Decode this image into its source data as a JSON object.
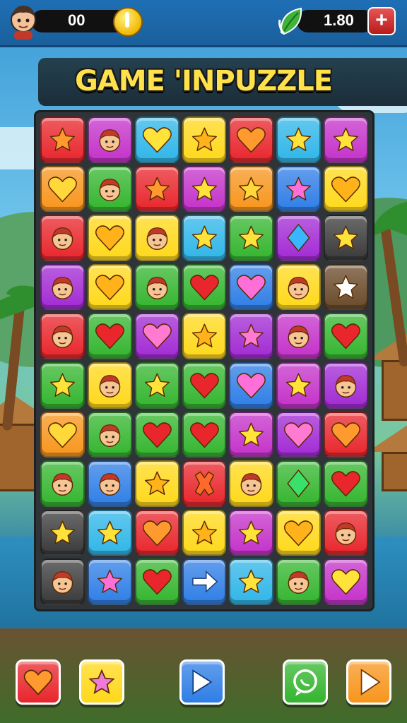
{
  "hud": {
    "coins": "00",
    "energy": "1.80",
    "plus_label": "+"
  },
  "title": "GAME 'INPUZZLE",
  "colors": {
    "red": "#e8262c",
    "orange": "#f7951d",
    "yellow": "#ffd81a",
    "green": "#34b52f",
    "cyan": "#2fb6e8",
    "blue": "#2f7ee6",
    "purple": "#a22ad4",
    "magenta": "#c432c9",
    "dark": "#3a3a3a",
    "brown": "#6a4a2a"
  },
  "board": {
    "rows": [
      [
        [
          "red",
          "star"
        ],
        [
          "magenta",
          "face"
        ],
        [
          "cyan",
          "heart"
        ],
        [
          "yellow",
          "star"
        ],
        [
          "red",
          "heart"
        ],
        [
          "cyan",
          "star"
        ],
        [
          "magenta",
          "star"
        ]
      ],
      [
        [
          "orange",
          "heart"
        ],
        [
          "green",
          "face"
        ],
        [
          "red",
          "star"
        ],
        [
          "magenta",
          "star"
        ],
        [
          "orange",
          "star"
        ],
        [
          "blue",
          "star"
        ],
        [
          "yellow",
          "heart"
        ]
      ],
      [
        [
          "red",
          "face"
        ],
        [
          "yellow",
          "heart"
        ],
        [
          "yellow",
          "face"
        ],
        [
          "cyan",
          "star"
        ],
        [
          "green",
          "star"
        ],
        [
          "purple",
          "diamond"
        ],
        [
          "dark",
          "star"
        ]
      ],
      [
        [
          "purple",
          "face"
        ],
        [
          "yellow",
          "heart"
        ],
        [
          "green",
          "face"
        ],
        [
          "green",
          "heart"
        ],
        [
          "blue",
          "heart"
        ],
        [
          "yellow",
          "face"
        ],
        [
          "brown",
          "star"
        ]
      ],
      [
        [
          "red",
          "face"
        ],
        [
          "green",
          "heart"
        ],
        [
          "purple",
          "heart"
        ],
        [
          "yellow",
          "star"
        ],
        [
          "purple",
          "star"
        ],
        [
          "magenta",
          "face"
        ],
        [
          "green",
          "heart"
        ]
      ],
      [
        [
          "green",
          "star"
        ],
        [
          "yellow",
          "face"
        ],
        [
          "green",
          "star"
        ],
        [
          "green",
          "heart"
        ],
        [
          "blue",
          "heart"
        ],
        [
          "magenta",
          "star"
        ],
        [
          "purple",
          "face"
        ]
      ],
      [
        [
          "orange",
          "heart"
        ],
        [
          "green",
          "face"
        ],
        [
          "green",
          "heart"
        ],
        [
          "green",
          "heart"
        ],
        [
          "magenta",
          "star"
        ],
        [
          "purple",
          "heart"
        ],
        [
          "red",
          "heart"
        ]
      ],
      [
        [
          "green",
          "face"
        ],
        [
          "blue",
          "face"
        ],
        [
          "yellow",
          "star"
        ],
        [
          "red",
          "cross"
        ],
        [
          "yellow",
          "face"
        ],
        [
          "green",
          "diamond"
        ],
        [
          "green",
          "heart"
        ]
      ],
      [
        [
          "dark",
          "star"
        ],
        [
          "cyan",
          "star"
        ],
        [
          "red",
          "heart"
        ],
        [
          "yellow",
          "star"
        ],
        [
          "magenta",
          "star"
        ],
        [
          "yellow",
          "heart"
        ],
        [
          "red",
          "face"
        ]
      ],
      [
        [
          "dark",
          "face"
        ],
        [
          "blue",
          "star"
        ],
        [
          "green",
          "heart"
        ],
        [
          "blue",
          "arrow"
        ],
        [
          "cyan",
          "star"
        ],
        [
          "green",
          "face"
        ],
        [
          "magenta",
          "heart"
        ]
      ]
    ]
  },
  "bottom_buttons": [
    {
      "name": "heart-booster-button",
      "color": "red",
      "icon": "heart-icon"
    },
    {
      "name": "star-booster-button",
      "color": "yellow",
      "icon": "star-icon"
    },
    {
      "name": "play-next-button",
      "color": "blue",
      "icon": "arrow-right-icon"
    },
    {
      "name": "chat-button",
      "color": "green",
      "icon": "chat-icon"
    },
    {
      "name": "play-button",
      "color": "orange",
      "icon": "play-icon"
    }
  ]
}
